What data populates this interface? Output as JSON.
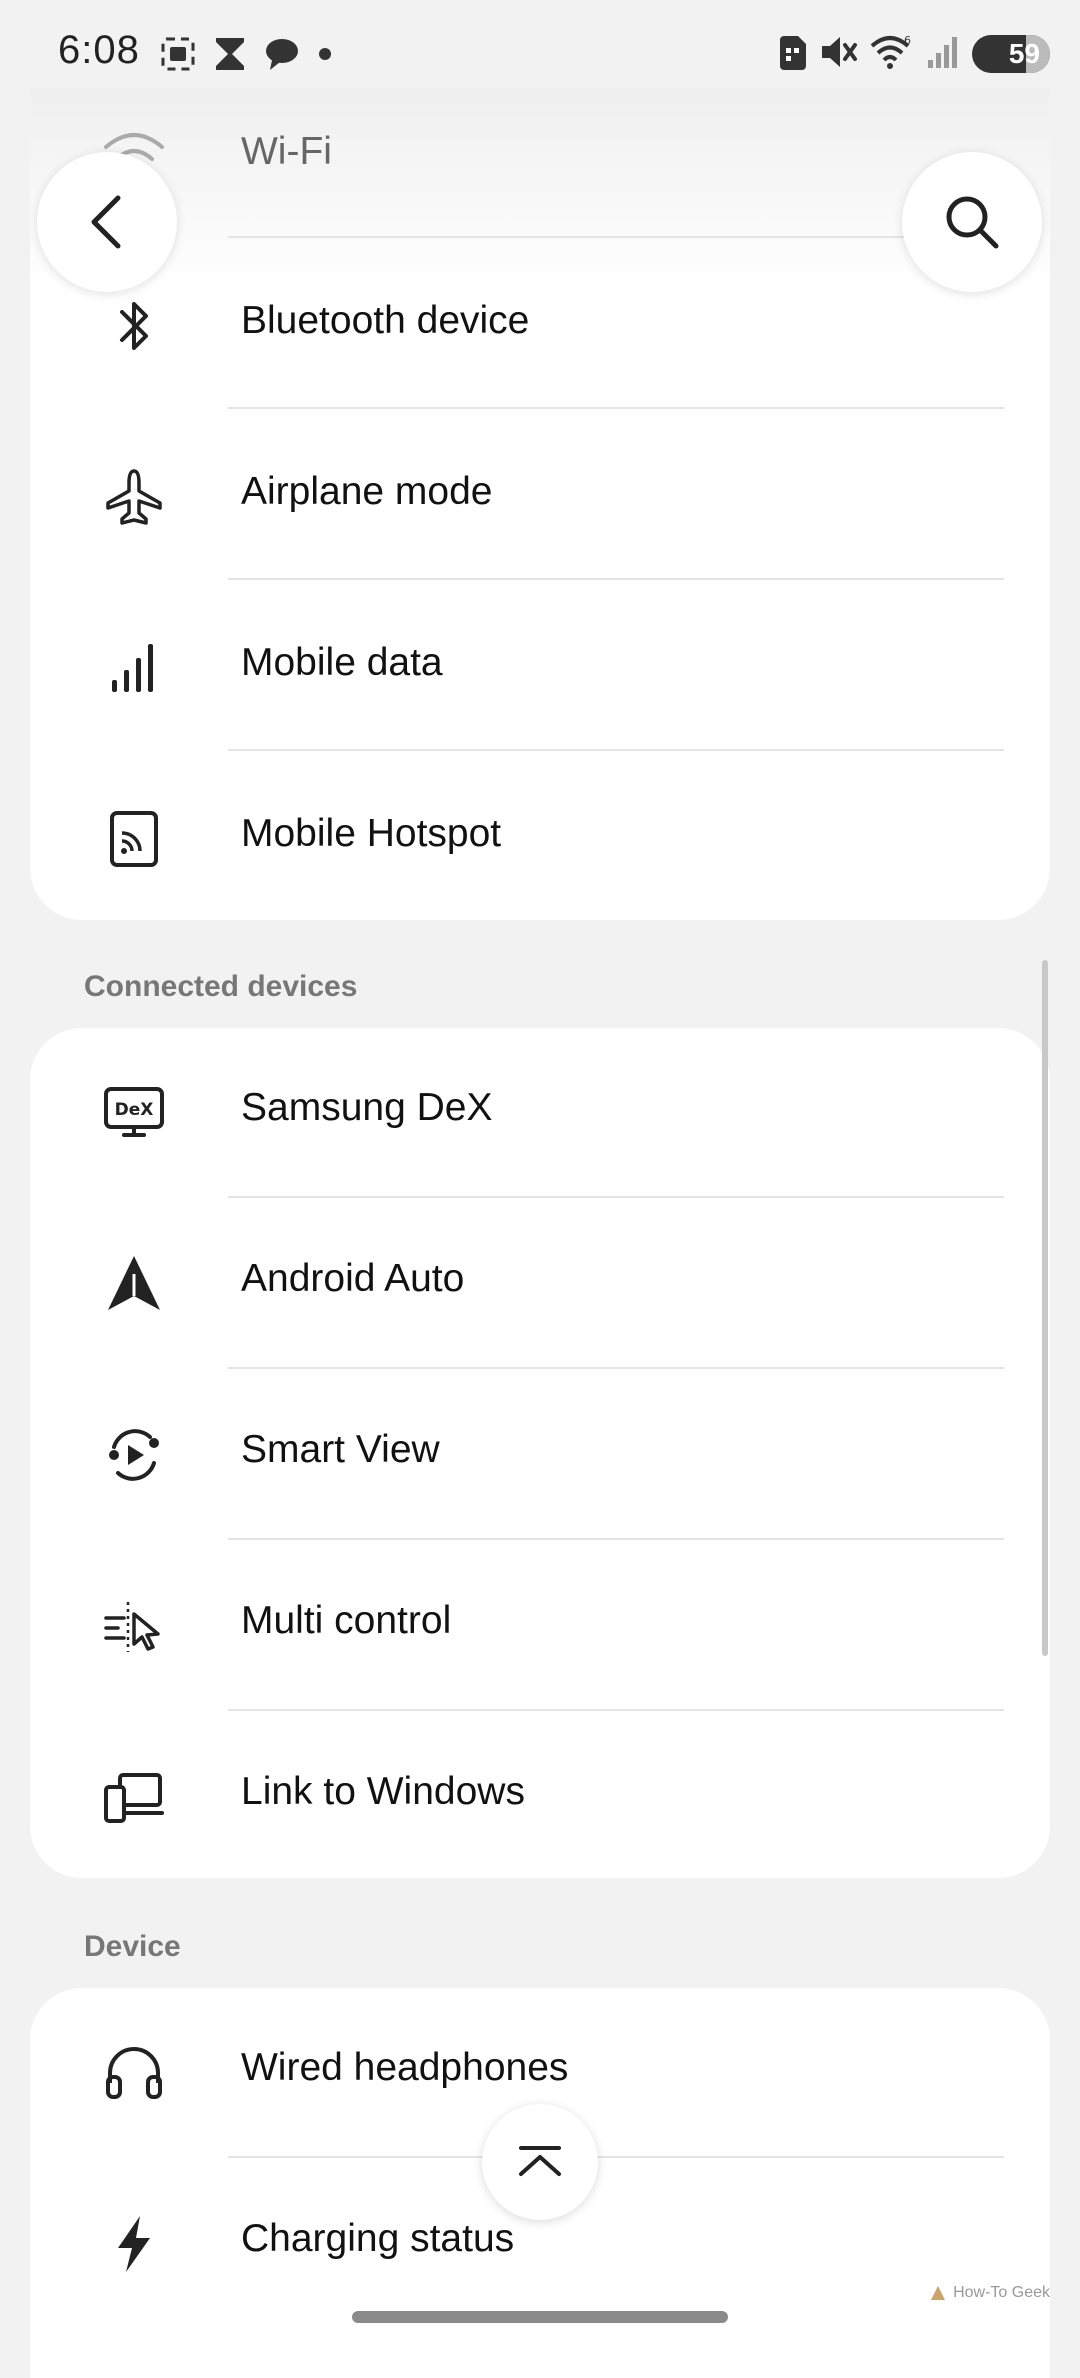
{
  "status_bar": {
    "time": "6:08",
    "battery": "59"
  },
  "network": {
    "items": [
      {
        "label": "Wi-Fi",
        "icon": "wifi-icon"
      },
      {
        "label": "Bluetooth device",
        "icon": "bluetooth-icon"
      },
      {
        "label": "Airplane mode",
        "icon": "airplane-icon"
      },
      {
        "label": "Mobile data",
        "icon": "signal-bars-icon"
      },
      {
        "label": "Mobile Hotspot",
        "icon": "hotspot-icon"
      }
    ]
  },
  "connected_devices": {
    "title": "Connected devices",
    "items": [
      {
        "label": "Samsung DeX",
        "icon": "dex-icon"
      },
      {
        "label": "Android Auto",
        "icon": "android-auto-icon"
      },
      {
        "label": "Smart View",
        "icon": "smart-view-icon"
      },
      {
        "label": "Multi control",
        "icon": "multi-control-icon"
      },
      {
        "label": "Link to Windows",
        "icon": "link-to-windows-icon"
      }
    ]
  },
  "device": {
    "title": "Device",
    "items": [
      {
        "label": "Wired headphones",
        "icon": "headphones-icon"
      },
      {
        "label": "Charging status",
        "icon": "lightning-icon"
      }
    ]
  },
  "watermark": "How-To Geek"
}
